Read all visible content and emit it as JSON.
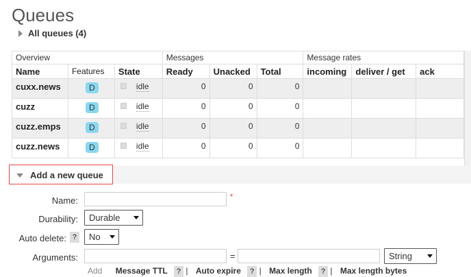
{
  "page": {
    "title": "Queues"
  },
  "all_queues": {
    "label": "All queues (4)"
  },
  "table": {
    "groups": [
      "Overview",
      "Messages",
      "Message rates"
    ],
    "columns": [
      "Name",
      "Features",
      "State",
      "Ready",
      "Unacked",
      "Total",
      "incoming",
      "deliver / get",
      "ack"
    ],
    "rows": [
      {
        "name": "cuxx.news",
        "feature": "D",
        "state": "idle",
        "ready": "0",
        "unacked": "0",
        "total": "0"
      },
      {
        "name": "cuzz",
        "feature": "D",
        "state": "idle",
        "ready": "0",
        "unacked": "0",
        "total": "0"
      },
      {
        "name": "cuzz.emps",
        "feature": "D",
        "state": "idle",
        "ready": "0",
        "unacked": "0",
        "total": "0"
      },
      {
        "name": "cuzz.news",
        "feature": "D",
        "state": "idle",
        "ready": "0",
        "unacked": "0",
        "total": "0"
      }
    ]
  },
  "add_queue": {
    "label": "Add a new queue",
    "name_label": "Name:",
    "name_value": "",
    "required_mark": "*",
    "durability_label": "Durability:",
    "durability_value": "Durable",
    "auto_delete_label": "Auto delete:",
    "auto_delete_help": "?",
    "auto_delete_value": "No",
    "arguments_label": "Arguments:",
    "arguments_key": "",
    "equals": "=",
    "arguments_value": "",
    "arguments_type": "String",
    "add_label": "Add",
    "shortcuts": [
      "Message TTL",
      "Auto expire",
      "Max length",
      "Max length bytes"
    ],
    "help_mark": "?",
    "sep": "|"
  }
}
